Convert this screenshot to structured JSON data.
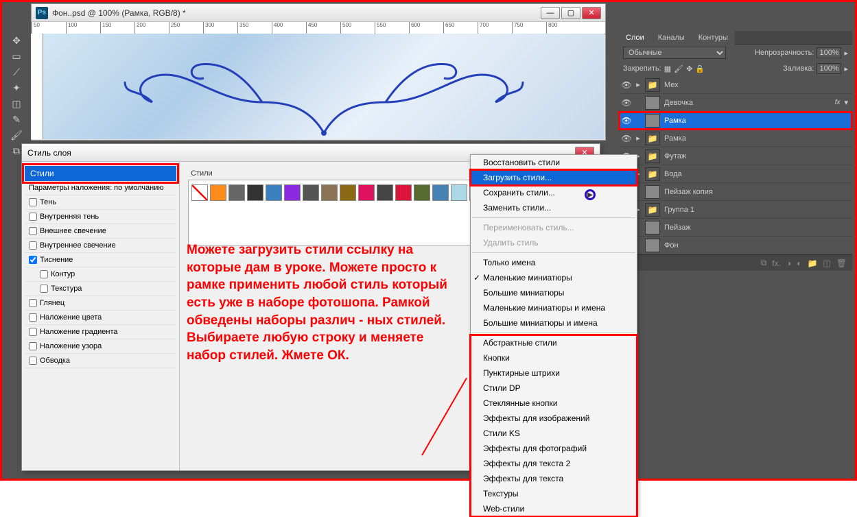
{
  "document": {
    "title": "Фон..psd @ 100% (Рамка, RGB/8) *"
  },
  "layersPanel": {
    "tabs": [
      "Слои",
      "Каналы",
      "Контуры"
    ],
    "blendMode": "Обычные",
    "opacityLabel": "Непрозрачность:",
    "opacityValue": "100%",
    "lockLabel": "Закрепить:",
    "fillLabel": "Заливка:",
    "fillValue": "100%",
    "layers": [
      {
        "name": "Мех",
        "type": "folder"
      },
      {
        "name": "Девочка",
        "type": "layer",
        "fx": "fx"
      },
      {
        "name": "Рамка",
        "type": "layer",
        "selected": true
      },
      {
        "name": "Рамка",
        "type": "folder"
      },
      {
        "name": "Футаж",
        "type": "folder"
      },
      {
        "name": "Вода",
        "type": "folder"
      },
      {
        "name": "Пейзаж копия",
        "type": "layer"
      },
      {
        "name": "Группа 1",
        "type": "folder"
      },
      {
        "name": "Пейзаж",
        "type": "layer"
      },
      {
        "name": "Фон",
        "type": "layer"
      }
    ]
  },
  "styleDialog": {
    "title": "Стиль слоя",
    "stylesHeading": "Стили",
    "paramsHeading": "Параметры наложения: по умолчанию",
    "effects": [
      {
        "label": "Тень",
        "checked": false
      },
      {
        "label": "Внутренняя тень",
        "checked": false
      },
      {
        "label": "Внешнее свечение",
        "checked": false
      },
      {
        "label": "Внутреннее свечение",
        "checked": false
      },
      {
        "label": "Тиснение",
        "checked": true
      },
      {
        "label": "Контур",
        "checked": false,
        "sub": true
      },
      {
        "label": "Текстура",
        "checked": false,
        "sub": true
      },
      {
        "label": "Глянец",
        "checked": false
      },
      {
        "label": "Наложение цвета",
        "checked": false
      },
      {
        "label": "Наложение градиента",
        "checked": false
      },
      {
        "label": "Наложение узора",
        "checked": false
      },
      {
        "label": "Обводка",
        "checked": false
      }
    ],
    "stylesLabel": "Стили",
    "swatchColors": [
      "none",
      "#ff8c1a",
      "#666",
      "#333",
      "#3b7fbf",
      "#8a2be2",
      "#555",
      "#8b7355",
      "#8b6914",
      "#e0115f",
      "#444",
      "#dc143c",
      "#556b2f",
      "#4682b4",
      "#add8e6",
      "#36c",
      "#888",
      "#aaa",
      "#777",
      "#555"
    ]
  },
  "annotation": "Можете загрузить стили ссылку на которые дам в уроке. Можете просто к рамке применить любой стиль который есть уже в наборе фотошопа. Рамкой обведены наборы различ - ных стилей. Выбираете любую строку и меняете набор стилей. Жмете ОК.",
  "contextMenu": {
    "groups": [
      [
        {
          "label": "Восстановить стили"
        },
        {
          "label": "Загрузить стили...",
          "selected": true
        },
        {
          "label": "Сохранить стили..."
        },
        {
          "label": "Заменить стили..."
        }
      ],
      [
        {
          "label": "Переименовать стиль...",
          "disabled": true
        },
        {
          "label": "Удалить стиль",
          "disabled": true
        }
      ],
      [
        {
          "label": "Только имена"
        },
        {
          "label": "Маленькие миниатюры",
          "checked": true
        },
        {
          "label": "Большие миниатюры"
        },
        {
          "label": "Маленькие миниатюры и имена"
        },
        {
          "label": "Большие миниатюры и имена"
        }
      ],
      [
        {
          "label": "Абстрактные стили"
        },
        {
          "label": "Кнопки"
        },
        {
          "label": "Пунктирные штрихи"
        },
        {
          "label": "Стили DP"
        },
        {
          "label": "Стеклянные кнопки"
        },
        {
          "label": "Эффекты для изображений"
        },
        {
          "label": "Стили KS"
        },
        {
          "label": "Эффекты для фотографий"
        },
        {
          "label": "Эффекты для текста 2"
        },
        {
          "label": "Эффекты для текста"
        },
        {
          "label": "Текстуры"
        },
        {
          "label": "Web-стили"
        }
      ]
    ]
  },
  "rulerMarks": [
    "50",
    "100",
    "150",
    "200",
    "250",
    "300",
    "350",
    "400",
    "450",
    "500",
    "550",
    "600",
    "650",
    "700",
    "750",
    "800"
  ]
}
